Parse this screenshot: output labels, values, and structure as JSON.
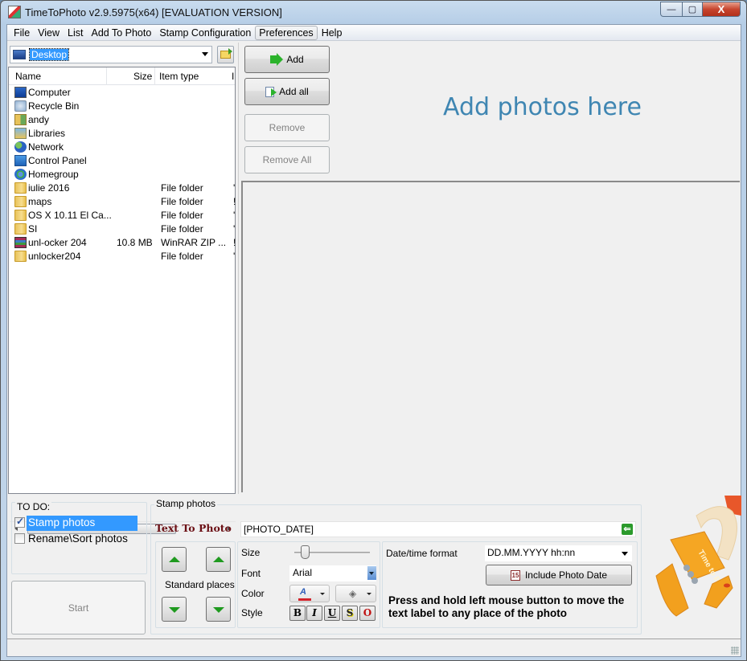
{
  "window": {
    "title": "TimeToPhoto v2.9.5975(x64) [EVALUATION VERSION]",
    "controls": {
      "minimize": "—",
      "maximize": "▢",
      "close": "X"
    }
  },
  "menu": [
    "File",
    "View",
    "List",
    "Add To Photo",
    "Stamp Configuration",
    "Preferences",
    "Help"
  ],
  "menu_active": "Preferences",
  "browser": {
    "location": "Desktop",
    "columns": {
      "name": "Name",
      "size": "Size",
      "type": "Item type",
      "extra": "I"
    },
    "items": [
      {
        "name": "Computer",
        "size": "",
        "type": "",
        "extra": "",
        "icon": "computer-icon"
      },
      {
        "name": "Recycle Bin",
        "size": "",
        "type": "",
        "extra": "",
        "icon": "recycle-bin-icon"
      },
      {
        "name": "andy",
        "size": "",
        "type": "",
        "extra": "",
        "icon": "user-folder-icon"
      },
      {
        "name": "Libraries",
        "size": "",
        "type": "",
        "extra": "",
        "icon": "libraries-icon"
      },
      {
        "name": "Network",
        "size": "",
        "type": "",
        "extra": "",
        "icon": "network-icon"
      },
      {
        "name": "Control Panel",
        "size": "",
        "type": "",
        "extra": "",
        "icon": "control-panel-icon"
      },
      {
        "name": "Homegroup",
        "size": "",
        "type": "",
        "extra": "",
        "icon": "homegroup-icon"
      },
      {
        "name": "iulie 2016",
        "size": "",
        "type": "File folder",
        "extra": "'",
        "icon": "folder-icon"
      },
      {
        "name": "maps",
        "size": "",
        "type": "File folder",
        "extra": "!",
        "icon": "folder-icon"
      },
      {
        "name": "OS X 10.11 El Ca...",
        "size": "",
        "type": "File folder",
        "extra": "'",
        "icon": "folder-icon"
      },
      {
        "name": "SI",
        "size": "",
        "type": "File folder",
        "extra": "'",
        "icon": "folder-icon"
      },
      {
        "name": "unl-ocker 204",
        "size": "10.8 MB",
        "type": "WinRAR ZIP ...",
        "extra": "!",
        "icon": "winrar-archive-icon"
      },
      {
        "name": "unlocker204",
        "size": "",
        "type": "File folder",
        "extra": "'",
        "icon": "folder-icon"
      }
    ],
    "scroll_thumb": "III"
  },
  "actions": {
    "add": "Add",
    "add_all": "Add all",
    "remove": "Remove",
    "remove_all": "Remove All"
  },
  "photo_area": {
    "placeholder": "Add photos here"
  },
  "todo": {
    "title": "TO DO:",
    "items": [
      {
        "label": "Stamp photos",
        "checked": true,
        "selected": true
      },
      {
        "label": "Rename\\Sort photos",
        "checked": false,
        "selected": false
      }
    ],
    "start": "Start"
  },
  "stamp": {
    "title": "Stamp photos",
    "text_label": "Text To Photo",
    "text_value": "[PHOTO_DATE]",
    "standard_places": "Standard places",
    "size_label": "Size",
    "size_value": 0.1,
    "font_label": "Font",
    "font_value": "Arial",
    "color_label": "Color",
    "style_label": "Style",
    "styles": [
      "B",
      "I",
      "U",
      "S",
      "O"
    ],
    "datetime_label": "Date/time format",
    "datetime_value": "DD.MM.YYYY hh:nn",
    "include_date": "Include Photo Date",
    "calendar_day": "15",
    "hint": "Press and hold left mouse button to move the text label to any place of the photo"
  },
  "logo": {
    "text": "Time to Photo"
  },
  "colors": {
    "accent_text": "#3f86b2",
    "text_to_photo": "#6b0f14",
    "selection": "#3399ff"
  }
}
